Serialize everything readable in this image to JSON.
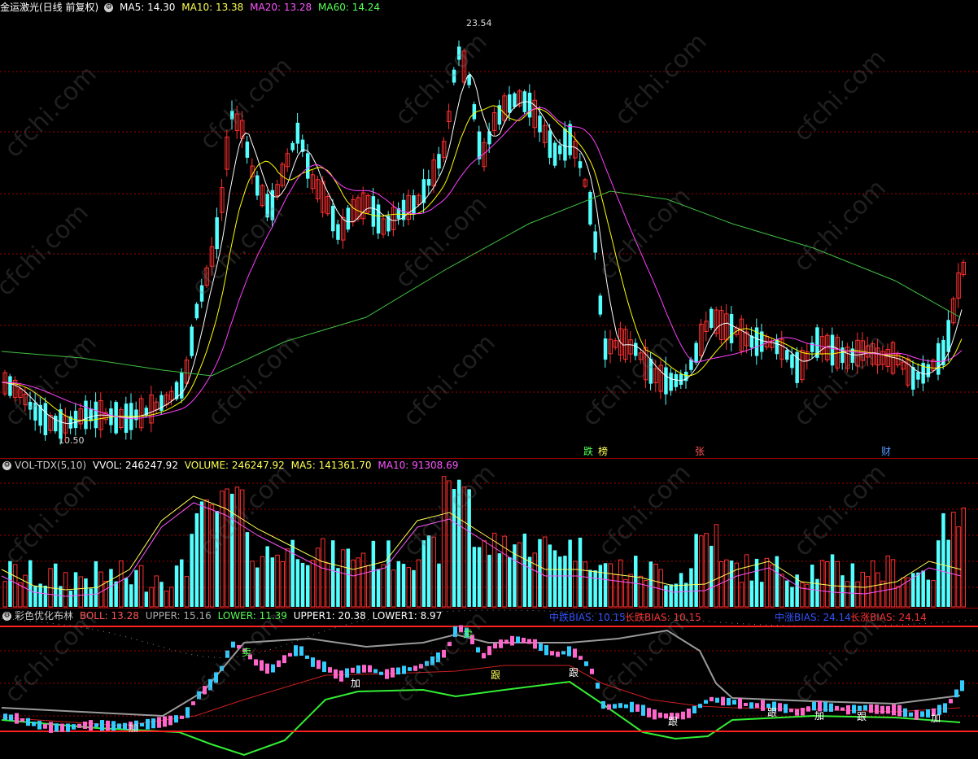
{
  "main": {
    "title": "金运激光(日线 前复权)",
    "ma": [
      {
        "label": "MA5: 14.30",
        "color": "#ffffff"
      },
      {
        "label": "MA10: 13.38",
        "color": "#ffff55"
      },
      {
        "label": "MA20: 13.28",
        "color": "#ff55ff"
      },
      {
        "label": "MA60: 14.24",
        "color": "#55ff55"
      }
    ],
    "high_label": "23.54",
    "low_label": "10.50",
    "event_marks": [
      "跌",
      "榜",
      "张",
      "财"
    ]
  },
  "volume": {
    "title": "VOL-TDX(5,10)",
    "vvol": "VVOL: 246247.92",
    "volume": "VOLUME: 246247.92",
    "ma5": "MA5: 141361.70",
    "ma10": "MA10: 91308.69"
  },
  "boll": {
    "title": "彩色优化布林",
    "boll": "BOLL: 13.28",
    "upper": "UPPER: 15.16",
    "lower": "LOWER: 11.39",
    "upper1": "UPPER1: 20.38",
    "lower1": "LOWER1: 8.97",
    "bias_mid_down": "中跌BIAS: 10.15",
    "bias_long_down": "长跌BIAS: 10.15",
    "bias_mid_up": "中涨BIAS: 24.14",
    "bias_long_up": "长涨BIAS: 24.14",
    "signals": [
      "卖",
      "卖",
      "加",
      "跟",
      "加",
      "跟",
      "跟",
      "加",
      "跟",
      "加",
      "跟"
    ]
  },
  "watermark": "cfchi.com",
  "colors": {
    "up": "#ff3030",
    "down": "#54ffff",
    "ma5": "#ffffff",
    "ma10": "#ffff00",
    "ma20": "#ff40ff",
    "ma60": "#40c040",
    "grid": "#a00000"
  }
}
